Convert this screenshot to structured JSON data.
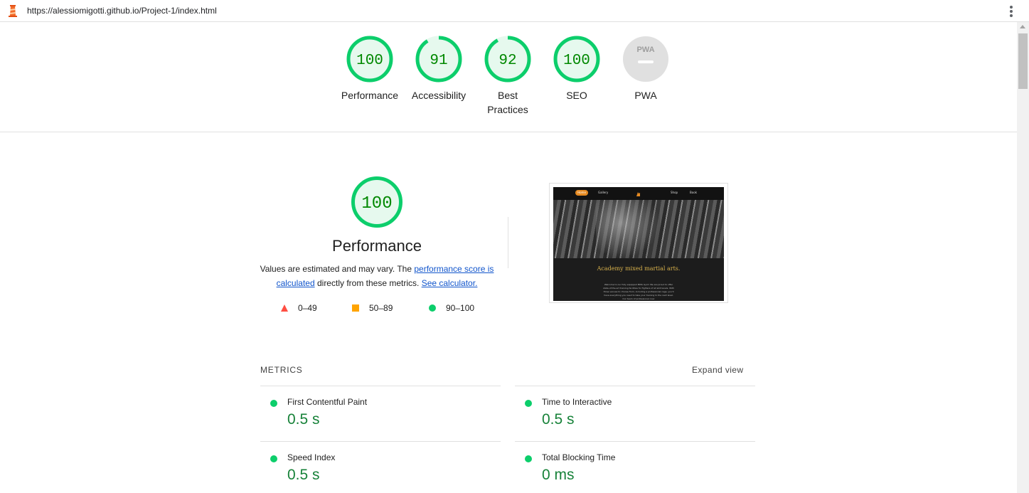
{
  "browser": {
    "url": "https://alessiomigotti.github.io/Project-1/index.html",
    "logo_icon": "lighthouse-icon",
    "menu_icon": "vertical-dots-menu-icon"
  },
  "colors": {
    "pass": "#0cce6b",
    "pass_text": "#008800",
    "average": "#ffa400",
    "fail": "#ff4e42",
    "link": "#1155cc",
    "na": "#e0e0e0"
  },
  "summary": {
    "categories": [
      {
        "label": "Performance",
        "score": "100",
        "fraction": 1.0
      },
      {
        "label": "Accessibility",
        "score": "91",
        "fraction": 0.91
      },
      {
        "label": "Best Practices",
        "score": "92",
        "fraction": 0.92
      },
      {
        "label": "SEO",
        "score": "100",
        "fraction": 1.0
      },
      {
        "label": "PWA",
        "score": "",
        "badge": "PWA"
      }
    ]
  },
  "performance": {
    "score": "100",
    "title": "Performance",
    "desc_prefix": "Values are estimated and may vary. The ",
    "desc_link1": "performance score is calculated",
    "desc_middle": " directly from these metrics. ",
    "desc_link2": "See calculator.",
    "legend": [
      {
        "range": "0–49",
        "shape": "triangle"
      },
      {
        "range": "50–89",
        "shape": "square"
      },
      {
        "range": "90–100",
        "shape": "circle"
      }
    ]
  },
  "screenshot": {
    "nav_home": "Home",
    "nav_gallery": "Gallery",
    "nav_shop": "Shop",
    "nav_book": "Book",
    "heading": "Academy mixed martial arts.",
    "body": "Welcome to our fully equipped MMA Gym! We are proud to offer state-of-the-art training facilities for fighters of all skill levels. With three venues to choose from, including a professional cage, you'll have everything you need to take your training to the next level. Our team of professional coac"
  },
  "metrics": {
    "header": "METRICS",
    "expand": "Expand view",
    "items": [
      {
        "name": "First Contentful Paint",
        "value": "0.5 s"
      },
      {
        "name": "Time to Interactive",
        "value": "0.5 s"
      },
      {
        "name": "Speed Index",
        "value": "0.5 s"
      },
      {
        "name": "Total Blocking Time",
        "value": "0 ms"
      }
    ]
  }
}
